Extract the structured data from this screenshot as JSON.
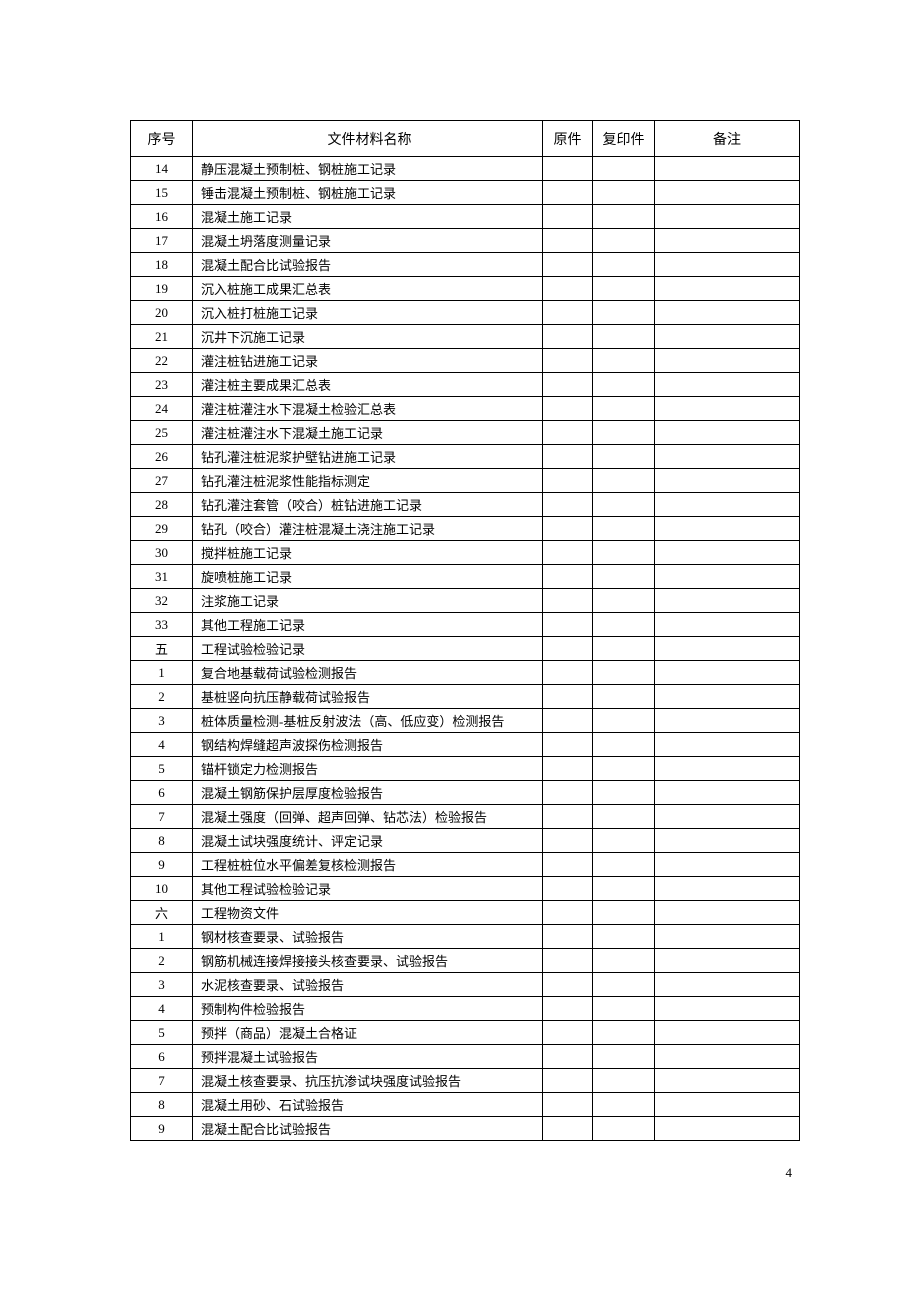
{
  "headers": {
    "seq": "序号",
    "name": "文件材料名称",
    "original": "原件",
    "copy": "复印件",
    "remark": "备注"
  },
  "rows": [
    {
      "seq": "14",
      "name": "静压混凝土预制桩、钢桩施工记录",
      "original": "",
      "copy": "",
      "remark": ""
    },
    {
      "seq": "15",
      "name": "锤击混凝土预制桩、钢桩施工记录",
      "original": "",
      "copy": "",
      "remark": ""
    },
    {
      "seq": "16",
      "name": "混凝土施工记录",
      "original": "",
      "copy": "",
      "remark": ""
    },
    {
      "seq": "17",
      "name": "混凝土坍落度测量记录",
      "original": "",
      "copy": "",
      "remark": ""
    },
    {
      "seq": "18",
      "name": "混凝土配合比试验报告",
      "original": "",
      "copy": "",
      "remark": ""
    },
    {
      "seq": "19",
      "name": "沉入桩施工成果汇总表",
      "original": "",
      "copy": "",
      "remark": ""
    },
    {
      "seq": "20",
      "name": "沉入桩打桩施工记录",
      "original": "",
      "copy": "",
      "remark": ""
    },
    {
      "seq": "21",
      "name": "沉井下沉施工记录",
      "original": "",
      "copy": "",
      "remark": ""
    },
    {
      "seq": "22",
      "name": "灌注桩钻进施工记录",
      "original": "",
      "copy": "",
      "remark": ""
    },
    {
      "seq": "23",
      "name": "灌注桩主要成果汇总表",
      "original": "",
      "copy": "",
      "remark": ""
    },
    {
      "seq": "24",
      "name": "灌注桩灌注水下混凝土检验汇总表",
      "original": "",
      "copy": "",
      "remark": ""
    },
    {
      "seq": "25",
      "name": "灌注桩灌注水下混凝土施工记录",
      "original": "",
      "copy": "",
      "remark": ""
    },
    {
      "seq": "26",
      "name": "钻孔灌注桩泥浆护壁钻进施工记录",
      "original": "",
      "copy": "",
      "remark": ""
    },
    {
      "seq": "27",
      "name": "钻孔灌注桩泥浆性能指标测定",
      "original": "",
      "copy": "",
      "remark": ""
    },
    {
      "seq": "28",
      "name": "钻孔灌注套管（咬合）桩钻进施工记录",
      "original": "",
      "copy": "",
      "remark": ""
    },
    {
      "seq": "29",
      "name": "钻孔（咬合）灌注桩混凝土浇注施工记录",
      "original": "",
      "copy": "",
      "remark": ""
    },
    {
      "seq": "30",
      "name": "搅拌桩施工记录",
      "original": "",
      "copy": "",
      "remark": ""
    },
    {
      "seq": "31",
      "name": "旋喷桩施工记录",
      "original": "",
      "copy": "",
      "remark": ""
    },
    {
      "seq": "32",
      "name": "注浆施工记录",
      "original": "",
      "copy": "",
      "remark": ""
    },
    {
      "seq": "33",
      "name": "其他工程施工记录",
      "original": "",
      "copy": "",
      "remark": ""
    },
    {
      "seq": "五",
      "name": "工程试验检验记录",
      "original": "",
      "copy": "",
      "remark": ""
    },
    {
      "seq": "1",
      "name": "复合地基载荷试验检测报告",
      "original": "",
      "copy": "",
      "remark": ""
    },
    {
      "seq": "2",
      "name": "基桩竖向抗压静载荷试验报告",
      "original": "",
      "copy": "",
      "remark": ""
    },
    {
      "seq": "3",
      "name": "桩体质量检测-基桩反射波法（高、低应变）检测报告",
      "original": "",
      "copy": "",
      "remark": ""
    },
    {
      "seq": "4",
      "name": "钢结构焊缝超声波探伤检测报告",
      "original": "",
      "copy": "",
      "remark": ""
    },
    {
      "seq": "5",
      "name": "锚杆锁定力检测报告",
      "original": "",
      "copy": "",
      "remark": ""
    },
    {
      "seq": "6",
      "name": "混凝土钢筋保护层厚度检验报告",
      "original": "",
      "copy": "",
      "remark": ""
    },
    {
      "seq": "7",
      "name": "混凝土强度（回弹、超声回弹、钻芯法）检验报告",
      "original": "",
      "copy": "",
      "remark": ""
    },
    {
      "seq": "8",
      "name": "混凝土试块强度统计、评定记录",
      "original": "",
      "copy": "",
      "remark": ""
    },
    {
      "seq": "9",
      "name": "工程桩桩位水平偏差复核检测报告",
      "original": "",
      "copy": "",
      "remark": ""
    },
    {
      "seq": "10",
      "name": "其他工程试验检验记录",
      "original": "",
      "copy": "",
      "remark": ""
    },
    {
      "seq": "六",
      "name": "工程物资文件",
      "original": "",
      "copy": "",
      "remark": ""
    },
    {
      "seq": "1",
      "name": "钢材核查要录、试验报告",
      "original": "",
      "copy": "",
      "remark": ""
    },
    {
      "seq": "2",
      "name": "钢筋机械连接焊接接头核查要录、试验报告",
      "original": "",
      "copy": "",
      "remark": ""
    },
    {
      "seq": "3",
      "name": "水泥核查要录、试验报告",
      "original": "",
      "copy": "",
      "remark": ""
    },
    {
      "seq": "4",
      "name": "预制构件检验报告",
      "original": "",
      "copy": "",
      "remark": ""
    },
    {
      "seq": "5",
      "name": "预拌（商品）混凝土合格证",
      "original": "",
      "copy": "",
      "remark": ""
    },
    {
      "seq": "6",
      "name": "预拌混凝土试验报告",
      "original": "",
      "copy": "",
      "remark": ""
    },
    {
      "seq": "7",
      "name": "混凝土核查要录、抗压抗渗试块强度试验报告",
      "original": "",
      "copy": "",
      "remark": ""
    },
    {
      "seq": "8",
      "name": "混凝土用砂、石试验报告",
      "original": "",
      "copy": "",
      "remark": ""
    },
    {
      "seq": "9",
      "name": "混凝土配合比试验报告",
      "original": "",
      "copy": "",
      "remark": ""
    }
  ],
  "pageNumber": "4"
}
